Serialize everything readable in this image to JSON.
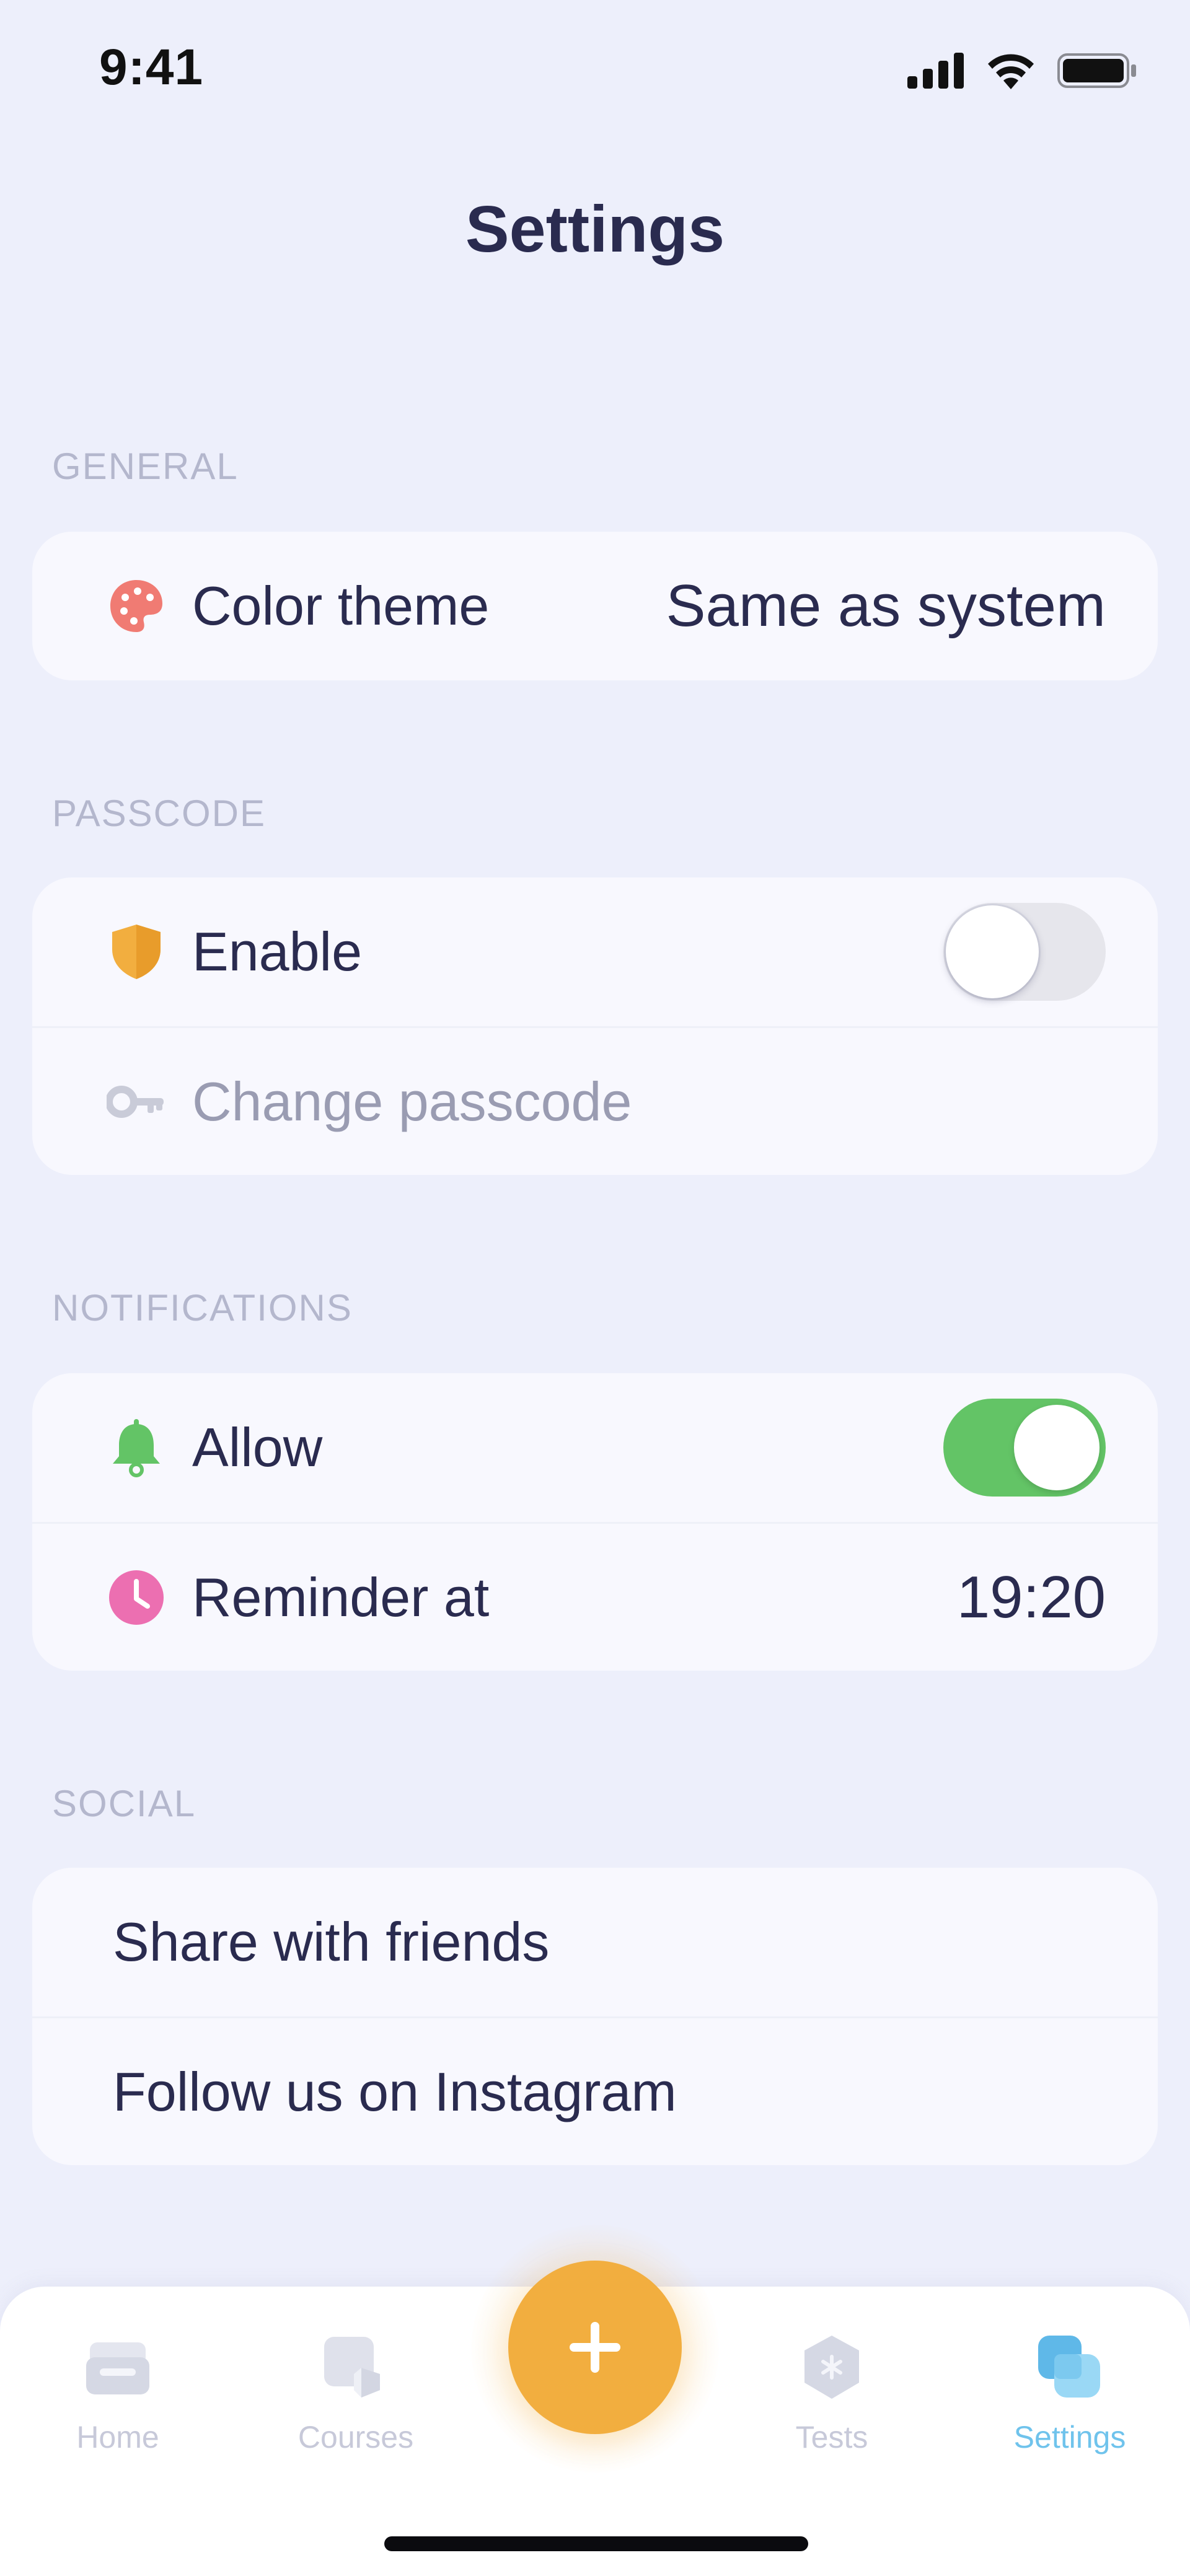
{
  "status_bar": {
    "time": "9:41"
  },
  "header": {
    "title": "Settings"
  },
  "sections": {
    "general": {
      "label": "GENERAL",
      "color_theme": {
        "label": "Color theme",
        "value": "Same as system",
        "icon": "palette-icon"
      }
    },
    "passcode": {
      "label": "PASSCODE",
      "enable": {
        "label": "Enable",
        "icon": "shield-icon",
        "toggle_on": false
      },
      "change_passcode": {
        "label": "Change passcode",
        "icon": "key-icon"
      }
    },
    "notifications": {
      "label": "NOTIFICATIONS",
      "allow": {
        "label": "Allow",
        "icon": "bell-icon",
        "toggle_on": true
      },
      "reminder": {
        "label": "Reminder at",
        "value": "19:20",
        "icon": "clock-icon"
      }
    },
    "social": {
      "label": "SOCIAL",
      "share": {
        "label": "Share with friends"
      },
      "instagram": {
        "label": "Follow us on Instagram"
      }
    }
  },
  "tab_bar": {
    "tabs": [
      {
        "label": "Home",
        "icon": "home-icon",
        "active": false
      },
      {
        "label": "Courses",
        "icon": "courses-icon",
        "active": false
      },
      {
        "label": "Tests",
        "icon": "tests-icon",
        "active": false
      },
      {
        "label": "Settings",
        "icon": "settings-tab-icon",
        "active": true
      }
    ],
    "add_icon": "plus-icon"
  },
  "colors": {
    "background": "#EDEFFB",
    "card": "#F8F8FE",
    "text": "#2A2B4F",
    "section_label": "#B4B7CD",
    "accent_orange": "#F2AE3F",
    "toggle_on": "#63C466",
    "active_tab": "#6FC3EC"
  }
}
